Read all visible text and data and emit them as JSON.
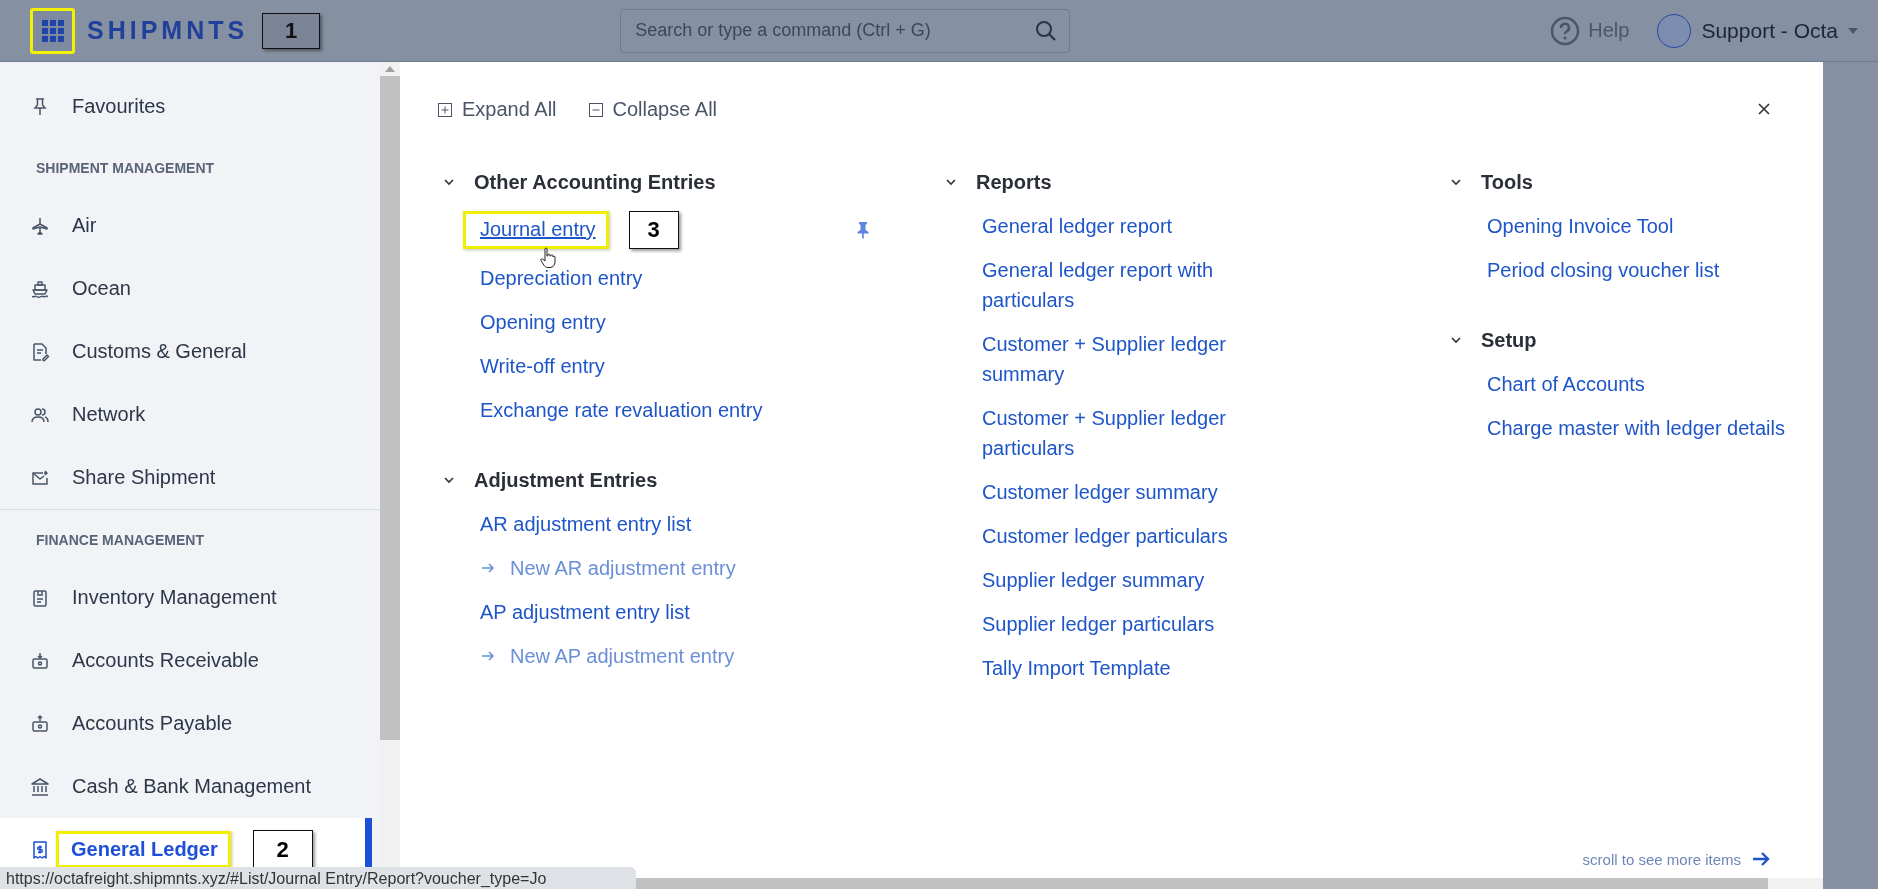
{
  "topbar": {
    "app_menu_button": {
      "highlighted": true,
      "callout": "1"
    },
    "logo": "SHIPMNTS",
    "search": {
      "placeholder": "Search or type a command (Ctrl + G)"
    },
    "help": "Help",
    "user": "Support - Octa"
  },
  "sidebar": {
    "favourites": "Favourites",
    "sections": [
      {
        "title": "SHIPMENT MANAGEMENT",
        "items": [
          {
            "label": "Air",
            "selected": false,
            "highlighted": false
          },
          {
            "label": "Ocean",
            "selected": false,
            "highlighted": false
          },
          {
            "label": "Customs & General",
            "selected": false,
            "highlighted": false
          },
          {
            "label": "Network",
            "selected": false,
            "highlighted": false
          },
          {
            "label": "Share Shipment",
            "selected": false,
            "highlighted": false
          }
        ]
      },
      {
        "title": "FINANCE MANAGEMENT",
        "items": [
          {
            "label": "Inventory Management",
            "selected": false,
            "highlighted": false
          },
          {
            "label": "Accounts Receivable",
            "selected": false,
            "highlighted": false
          },
          {
            "label": "Accounts Payable",
            "selected": false,
            "highlighted": false
          },
          {
            "label": "Cash & Bank Management",
            "selected": false,
            "highlighted": false
          },
          {
            "label": "General Ledger",
            "selected": true,
            "highlighted": true,
            "callout": "2"
          }
        ]
      }
    ]
  },
  "menu": {
    "toolbar": {
      "expand_all": "Expand All",
      "collapse_all": "Collapse All"
    },
    "columns": [
      {
        "groups": [
          {
            "title": "Other Accounting Entries",
            "expanded": true,
            "items": [
              {
                "kind": "link",
                "label": "Journal entry",
                "hovered": true,
                "pinned": true,
                "highlighted": true,
                "callout": "3"
              },
              {
                "kind": "link",
                "label": "Depreciation entry",
                "hovered": false,
                "pinned": false,
                "highlighted": false
              },
              {
                "kind": "link",
                "label": "Opening entry",
                "hovered": false,
                "pinned": false,
                "highlighted": false
              },
              {
                "kind": "link",
                "label": "Write-off entry",
                "hovered": false,
                "pinned": false,
                "highlighted": false
              },
              {
                "kind": "link",
                "label": "Exchange rate revaluation entry",
                "hovered": false,
                "pinned": false,
                "highlighted": false
              }
            ]
          },
          {
            "title": "Adjustment Entries",
            "expanded": true,
            "items": [
              {
                "kind": "link",
                "label": "AR adjustment entry list",
                "hovered": false,
                "pinned": false,
                "highlighted": false
              },
              {
                "kind": "action",
                "label": "New AR adjustment entry",
                "hovered": false,
                "pinned": false,
                "highlighted": false
              },
              {
                "kind": "link",
                "label": "AP adjustment entry list",
                "hovered": false,
                "pinned": false,
                "highlighted": false
              },
              {
                "kind": "action",
                "label": "New AP adjustment entry",
                "hovered": false,
                "pinned": false,
                "highlighted": false
              }
            ]
          }
        ]
      },
      {
        "groups": [
          {
            "title": "Reports",
            "expanded": true,
            "items": [
              {
                "kind": "link",
                "label": "General ledger report",
                "hovered": false,
                "pinned": false,
                "highlighted": false
              },
              {
                "kind": "link",
                "label": "General ledger report with particulars",
                "hovered": false,
                "pinned": false,
                "highlighted": false
              },
              {
                "kind": "link",
                "label": "Customer + Supplier ledger summary",
                "hovered": false,
                "pinned": false,
                "highlighted": false
              },
              {
                "kind": "link",
                "label": "Customer + Supplier ledger particulars",
                "hovered": false,
                "pinned": false,
                "highlighted": false
              },
              {
                "kind": "link",
                "label": "Customer ledger summary",
                "hovered": false,
                "pinned": false,
                "highlighted": false
              },
              {
                "kind": "link",
                "label": "Customer ledger particulars",
                "hovered": false,
                "pinned": false,
                "highlighted": false
              },
              {
                "kind": "link",
                "label": "Supplier ledger summary",
                "hovered": false,
                "pinned": false,
                "highlighted": false
              },
              {
                "kind": "link",
                "label": "Supplier ledger particulars",
                "hovered": false,
                "pinned": false,
                "highlighted": false
              },
              {
                "kind": "link",
                "label": "Tally Import Template",
                "hovered": false,
                "pinned": false,
                "highlighted": false
              }
            ]
          }
        ]
      },
      {
        "groups": [
          {
            "title": "Tools",
            "expanded": true,
            "items": [
              {
                "kind": "link",
                "label": "Opening Invoice Tool",
                "hovered": false,
                "pinned": false,
                "highlighted": false
              },
              {
                "kind": "link",
                "label": "Period closing voucher list",
                "hovered": false,
                "pinned": false,
                "highlighted": false
              }
            ]
          },
          {
            "title": "Setup",
            "expanded": true,
            "items": [
              {
                "kind": "link",
                "label": "Chart of Accounts",
                "hovered": false,
                "pinned": false,
                "highlighted": false
              },
              {
                "kind": "link",
                "label": "Charge master with ledger details",
                "hovered": false,
                "pinned": false,
                "highlighted": false
              }
            ]
          }
        ]
      }
    ],
    "scroll_hint": "scroll to see more items"
  },
  "status_bar": {
    "url": "https://octafreight.shipmnts.xyz/#List/Journal Entry/Report?voucher_type=Jo"
  }
}
